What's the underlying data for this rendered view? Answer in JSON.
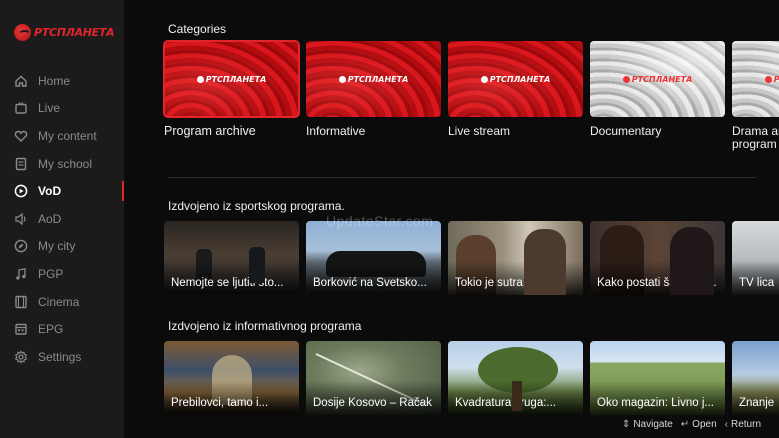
{
  "app": {
    "logo_text": "РТСПЛАНЕТА",
    "brand_color": "#e0262a"
  },
  "sidebar": {
    "items": [
      {
        "label": "Home",
        "icon": "home-icon",
        "active": false
      },
      {
        "label": "Live",
        "icon": "tv-icon",
        "active": false
      },
      {
        "label": "My content",
        "icon": "heart-icon",
        "active": false
      },
      {
        "label": "My school",
        "icon": "book-icon",
        "active": false
      },
      {
        "label": "VoD",
        "icon": "play-circle-icon",
        "active": true
      },
      {
        "label": "AoD",
        "icon": "speaker-icon",
        "active": false
      },
      {
        "label": "My city",
        "icon": "compass-icon",
        "active": false
      },
      {
        "label": "PGP",
        "icon": "music-note-icon",
        "active": false
      },
      {
        "label": "Cinema",
        "icon": "film-icon",
        "active": false
      },
      {
        "label": "EPG",
        "icon": "calendar-icon",
        "active": false
      },
      {
        "label": "Settings",
        "icon": "gear-icon",
        "active": false
      }
    ]
  },
  "categories": {
    "title": "Categories",
    "brand_text": "РТСПЛАНЕТА",
    "items": [
      {
        "label": "Program archive",
        "style": "red",
        "focused": true
      },
      {
        "label": "Informative",
        "style": "red",
        "focused": false
      },
      {
        "label": "Live stream",
        "style": "red",
        "focused": false
      },
      {
        "label": "Documentary",
        "style": "grey",
        "focused": false
      },
      {
        "label": "Drama and series program",
        "style": "grey",
        "focused": false
      }
    ]
  },
  "sports": {
    "title": "Izdvojeno iz sportskog programa.",
    "items": [
      {
        "title": "Nemojte se ljutiti što..."
      },
      {
        "title": "Borković na Svetsko..."
      },
      {
        "title": "Tokio je sutra, ljudi:..."
      },
      {
        "title": "Kako postati šampion..."
      },
      {
        "title": "TV lica"
      }
    ]
  },
  "info": {
    "title": "Izdvojeno iz informativnog programa",
    "items": [
      {
        "title": "Prebilovci, tamo i..."
      },
      {
        "title": "Dosije Kosovo – Račak"
      },
      {
        "title": "Kvadratura kruga:..."
      },
      {
        "title": "Oko magazin: Livno j..."
      },
      {
        "title": "Znanje"
      }
    ]
  },
  "watermark": "UpdateStar.com",
  "footer": {
    "navigate": "Navigate",
    "open": "Open",
    "return": "Return"
  }
}
